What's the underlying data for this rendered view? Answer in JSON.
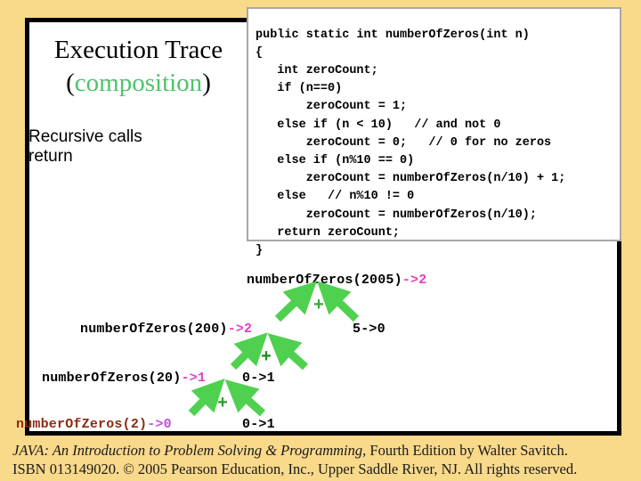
{
  "slide": {
    "background_color": "#f9d98a",
    "panel_color": "#ffffff",
    "panel_border_color": "#000000"
  },
  "title": {
    "line1": "Execution Trace",
    "paren_open": "(",
    "highlight_word": "composition",
    "paren_close": ")",
    "highlight_color": "#4ec36a"
  },
  "subtitle": {
    "line1": "Recursive calls",
    "line2": "return"
  },
  "code_box": {
    "language": "java",
    "border_color": "#a8a8a8",
    "text": "public static int numberOfZeros(int n)\n{\n   int zeroCount;\n   if (n==0)\n       zeroCount = 1;\n   else if (n < 10)   // and not 0\n       zeroCount = 0;   // 0 for no zeros\n   else if (n%10 == 0)\n       zeroCount = numberOfZeros(n/10) + 1;\n   else   // n%10 != 0\n       zeroCount = numberOfZeros(n/10);\n   return zeroCount;\n}",
    "lines": [
      "public static int numberOfZeros(int n)",
      "{",
      "   int zeroCount;",
      "   if (n==0)",
      "       zeroCount = 1;",
      "   else if (n < 10)   // and not 0",
      "       zeroCount = 0;   // 0 for no zeros",
      "   else if (n%10 == 0)",
      "       zeroCount = numberOfZeros(n/10) + 1;",
      "   else   // n%10 != 0",
      "       zeroCount = numberOfZeros(n/10);",
      "   return zeroCount;",
      "}"
    ]
  },
  "trace": {
    "result_color": "#e23fc0",
    "arrow_color": "#4fd14f",
    "plus_color": "#3aa83a",
    "rows": [
      {
        "id": "row0",
        "call": "numberOfZeros(2005)",
        "result": "->2",
        "sibling": null
      },
      {
        "id": "row1",
        "call": "numberOfZeros(200)",
        "result": "->2",
        "sibling": "5->0"
      },
      {
        "id": "row2",
        "call": "numberOfZeros(20)",
        "result": "->1",
        "sibling": "0->1"
      },
      {
        "id": "row3",
        "call": "numberOfZeros(2)",
        "result": "->0",
        "sibling": "0->1"
      }
    ],
    "plus_signs": [
      "+",
      "+",
      "+"
    ]
  },
  "footer": {
    "line1_italic": "JAVA: An Introduction to Problem Solving & Programming",
    "line1_rest": ", Fourth Edition by Walter Savitch.",
    "line2": "ISBN 013149020. © 2005 Pearson Education, Inc., Upper Saddle River, NJ. All rights reserved."
  }
}
